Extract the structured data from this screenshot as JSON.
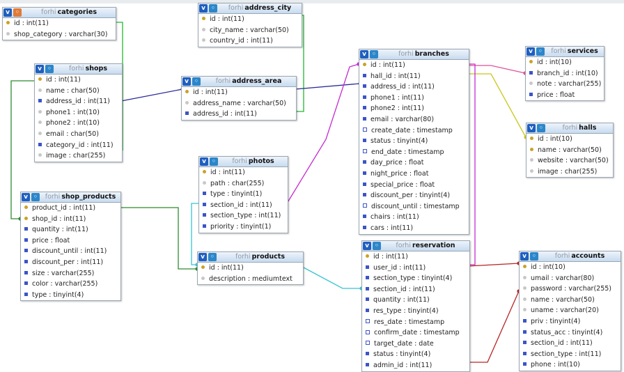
{
  "db": "forhi",
  "tables": [
    {
      "id": "categories",
      "name": "categories",
      "cols": [
        {
          "t": "id : int(11)",
          "i": "key"
        },
        {
          "t": "shop_category : varchar(30)",
          "i": "dot"
        }
      ]
    },
    {
      "id": "shops",
      "name": "shops",
      "cols": [
        {
          "t": "id : int(11)",
          "i": "key"
        },
        {
          "t": "name : char(50)",
          "i": "dot"
        },
        {
          "t": "address_id : int(11)",
          "i": "col"
        },
        {
          "t": "phone1 : int(10)",
          "i": "dot"
        },
        {
          "t": "phone2 : int(10)",
          "i": "dot"
        },
        {
          "t": "email : char(50)",
          "i": "dot"
        },
        {
          "t": "category_id : int(11)",
          "i": "col"
        },
        {
          "t": "image : char(255)",
          "i": "dot"
        }
      ]
    },
    {
      "id": "shop_products",
      "name": "shop_products",
      "cols": [
        {
          "t": "product_id : int(11)",
          "i": "key"
        },
        {
          "t": "shop_id : int(11)",
          "i": "key"
        },
        {
          "t": "quantity : int(11)",
          "i": "col"
        },
        {
          "t": "price : float",
          "i": "col"
        },
        {
          "t": "discount_until : int(11)",
          "i": "col"
        },
        {
          "t": "discount_per : int(11)",
          "i": "col"
        },
        {
          "t": "size : varchar(255)",
          "i": "col"
        },
        {
          "t": "color : varchar(255)",
          "i": "col"
        },
        {
          "t": "type : tinyint(4)",
          "i": "col"
        }
      ]
    },
    {
      "id": "address_city",
      "name": "address_city",
      "cols": [
        {
          "t": "id : int(11)",
          "i": "key"
        },
        {
          "t": "city_name : varchar(50)",
          "i": "dot"
        },
        {
          "t": "country_id : int(11)",
          "i": "dot"
        }
      ]
    },
    {
      "id": "address_area",
      "name": "address_area",
      "cols": [
        {
          "t": "id : int(11)",
          "i": "key"
        },
        {
          "t": "address_name : varchar(50)",
          "i": "dot"
        },
        {
          "t": "address_id : int(11)",
          "i": "col"
        }
      ]
    },
    {
      "id": "photos",
      "name": "photos",
      "cols": [
        {
          "t": "id : int(11)",
          "i": "key"
        },
        {
          "t": "path : char(255)",
          "i": "dot"
        },
        {
          "t": "type : tinyint(1)",
          "i": "col"
        },
        {
          "t": "section_id : int(11)",
          "i": "col"
        },
        {
          "t": "section_type : int(11)",
          "i": "col"
        },
        {
          "t": "priority : tinyint(1)",
          "i": "col"
        }
      ]
    },
    {
      "id": "products",
      "name": "products",
      "cols": [
        {
          "t": "id : int(11)",
          "i": "key"
        },
        {
          "t": "description : mediumtext",
          "i": "dot"
        }
      ]
    },
    {
      "id": "branches",
      "name": "branches",
      "cols": [
        {
          "t": "id : int(11)",
          "i": "key"
        },
        {
          "t": "hall_id : int(11)",
          "i": "col"
        },
        {
          "t": "address_id : int(11)",
          "i": "col"
        },
        {
          "t": "phone1 : int(11)",
          "i": "col"
        },
        {
          "t": "phone2 : int(11)",
          "i": "col"
        },
        {
          "t": "email : varchar(80)",
          "i": "col"
        },
        {
          "t": "create_date : timestamp",
          "i": "idx"
        },
        {
          "t": "status : tinyint(4)",
          "i": "col"
        },
        {
          "t": "end_date : timestamp",
          "i": "idx"
        },
        {
          "t": "day_price : float",
          "i": "col"
        },
        {
          "t": "night_price : float",
          "i": "col"
        },
        {
          "t": "special_price : float",
          "i": "col"
        },
        {
          "t": "discount_per : tinyint(4)",
          "i": "col"
        },
        {
          "t": "discount_until : timestamp",
          "i": "idx"
        },
        {
          "t": "chairs : int(11)",
          "i": "col"
        },
        {
          "t": "cars : int(11)",
          "i": "col"
        }
      ]
    },
    {
      "id": "reservation",
      "name": "reservation",
      "cols": [
        {
          "t": "id : int(11)",
          "i": "key"
        },
        {
          "t": "user_id : int(11)",
          "i": "col"
        },
        {
          "t": "section_type : tinyint(4)",
          "i": "col"
        },
        {
          "t": "section_id : int(11)",
          "i": "col"
        },
        {
          "t": "quantity : int(11)",
          "i": "col"
        },
        {
          "t": "res_type : tinyint(4)",
          "i": "col"
        },
        {
          "t": "res_date : timestamp",
          "i": "idx"
        },
        {
          "t": "confirm_date : timestamp",
          "i": "idx"
        },
        {
          "t": "target_date : date",
          "i": "idx"
        },
        {
          "t": "status : tinyint(4)",
          "i": "col"
        },
        {
          "t": "admin_id : int(11)",
          "i": "col"
        }
      ]
    },
    {
      "id": "services",
      "name": "services",
      "cols": [
        {
          "t": "id : int(10)",
          "i": "key"
        },
        {
          "t": "branch_id : int(10)",
          "i": "col"
        },
        {
          "t": "note : varchar(255)",
          "i": "dot"
        },
        {
          "t": "price : float",
          "i": "col"
        }
      ]
    },
    {
      "id": "halls",
      "name": "halls",
      "cols": [
        {
          "t": "id : int(10)",
          "i": "key"
        },
        {
          "t": "name : varchar(50)",
          "i": "key"
        },
        {
          "t": "website : varchar(50)",
          "i": "dot"
        },
        {
          "t": "image : char(255)",
          "i": "dot"
        }
      ]
    },
    {
      "id": "accounts",
      "name": "accounts",
      "cols": [
        {
          "t": "id : int(10)",
          "i": "key"
        },
        {
          "t": "umail : varchar(80)",
          "i": "dot"
        },
        {
          "t": "password : varchar(255)",
          "i": "dot"
        },
        {
          "t": "name : varchar(50)",
          "i": "dot"
        },
        {
          "t": "uname : varchar(20)",
          "i": "dot"
        },
        {
          "t": "priv : tinyint(4)",
          "i": "col"
        },
        {
          "t": "status_acc : tinyint(4)",
          "i": "col"
        },
        {
          "t": "section_id : int(11)",
          "i": "col"
        },
        {
          "t": "section_type : int(11)",
          "i": "col"
        },
        {
          "t": "phone : int(10)",
          "i": "col"
        }
      ]
    }
  ],
  "colors": {
    "green": "#22b830",
    "blue": "#2a2a9a",
    "magenta": "#c62ad0",
    "cyan": "#36c4d2",
    "yellow": "#c8c81e",
    "red": "#b82424",
    "pink": "#e0509a",
    "darkgreen": "#2e8b2e"
  }
}
